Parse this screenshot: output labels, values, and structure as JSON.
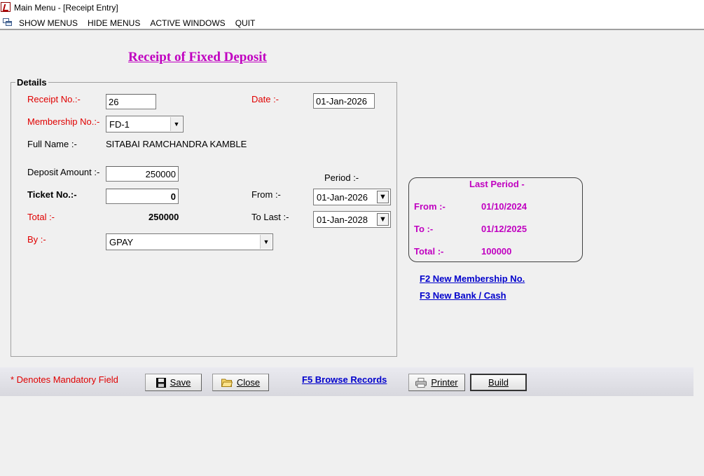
{
  "window": {
    "title": "Main Menu - [Receipt Entry]"
  },
  "menubar": {
    "items": [
      "SHOW MENUS",
      "HIDE MENUS",
      "ACTIVE WINDOWS",
      "QUIT"
    ]
  },
  "form": {
    "title": "Receipt of Fixed Deposit",
    "group_label": "Details",
    "receipt_no_label": "Receipt No.:-",
    "receipt_no_value": "26",
    "date_label": "Date :-",
    "date_value": "01-Jan-2026",
    "membership_label": "Membership No.:-",
    "membership_value": "FD-1",
    "full_name_label": "Full Name :-",
    "full_name_value": "SITABAI RAMCHANDRA KAMBLE",
    "deposit_label": "Deposit Amount :-",
    "deposit_value": "250000",
    "period_label": "Period :-",
    "ticket_label": "Ticket No.:-",
    "ticket_value": "0",
    "from_label": "From  :-",
    "from_value": "01-Jan-2026",
    "total_label": "Total :-",
    "total_value": "250000",
    "to_last_label": "To Last :-",
    "to_last_value": "01-Jan-2028",
    "by_label": "By :-",
    "by_value": "GPAY"
  },
  "last_period": {
    "title": "Last Period -",
    "from_label": "From :-",
    "from_value": "01/10/2024",
    "to_label": "To :-",
    "to_value": "01/12/2025",
    "total_label": "Total :-",
    "total_value": "100000"
  },
  "links": {
    "f2": "F2 New Membership No.",
    "f3": "F3 New Bank / Cash",
    "f5": "F5 Browse Records"
  },
  "footer": {
    "mandatory_note": "* Denotes Mandatory Field",
    "save": "Save",
    "close": "Close",
    "printer": "Printer",
    "build": "Build"
  }
}
